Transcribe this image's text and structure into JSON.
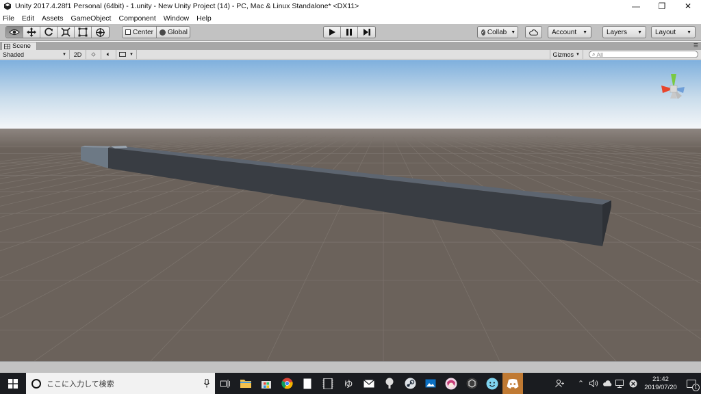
{
  "window": {
    "title": "Unity 2017.4.28f1 Personal (64bit) - 1.unity - New Unity Project (14) - PC, Mac & Linux Standalone* <DX11>",
    "controls": {
      "minimize": "—",
      "maximize": "❐",
      "close": "✕"
    }
  },
  "menu": {
    "items": [
      "File",
      "Edit",
      "Assets",
      "GameObject",
      "Component",
      "Window",
      "Help"
    ]
  },
  "toolbar": {
    "tools": [
      "hand-tool",
      "move-tool",
      "rotate-tool",
      "scale-tool",
      "rect-tool",
      "transform-tool"
    ],
    "active_tool": "hand-tool",
    "pivot_label": "Center",
    "space_label": "Global",
    "collab_label": "Collab",
    "account_label": "Account",
    "layers_label": "Layers",
    "layout_label": "Layout"
  },
  "scene_tab": {
    "label": "Scene"
  },
  "scene_toolbar": {
    "draw_mode": "Shaded",
    "mode_2d": "2D",
    "gizmos_label": "Gizmos",
    "search_placeholder": "All"
  },
  "viewport": {
    "colors": {
      "sky_top": "#7fb0dd",
      "sky_horizon": "#f4f6f8",
      "ground": "#6b625b",
      "object": "#3b3f45"
    }
  },
  "taskbar": {
    "search_placeholder": "ここに入力して検索",
    "pinned": [
      "task-view-icon",
      "file-explorer-icon",
      "store-icon",
      "chrome-icon",
      "notepad-icon",
      "video-icon",
      "ime-icon",
      "mail-icon",
      "podcast-icon",
      "steam-icon",
      "photos-icon",
      "character-app-icon",
      "unity-icon",
      "smiley-app-icon",
      "discord-icon"
    ],
    "clock_time": "21:42",
    "clock_date": "2019/07/20",
    "notification_count": "1"
  }
}
